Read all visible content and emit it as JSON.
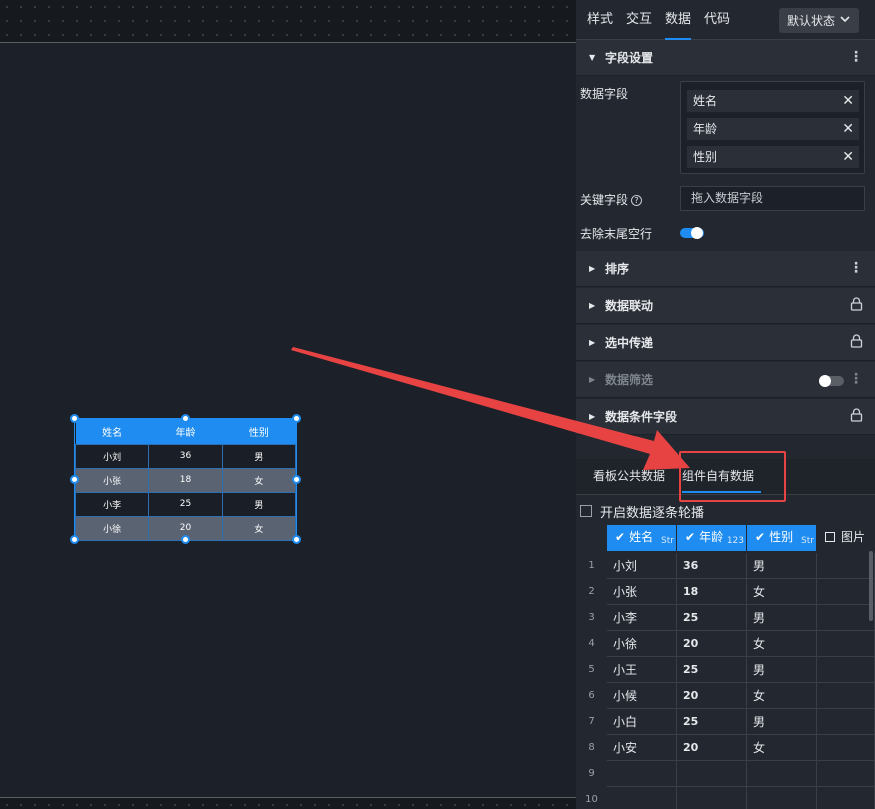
{
  "panel": {
    "tabs": [
      "样式",
      "交互",
      "数据",
      "代码"
    ],
    "active_tab": "数据",
    "state_select": "默认状态"
  },
  "field_settings": {
    "title": "字段设置",
    "data_fields_label": "数据字段",
    "data_fields": [
      "姓名",
      "年龄",
      "性别"
    ],
    "key_field_label": "关键字段",
    "key_field_placeholder": "拖入数据字段",
    "trim_empty_label": "去除末尾空行",
    "trim_empty_on": true
  },
  "sections": {
    "sort": "排序",
    "linkage": "数据联动",
    "selection": "选中传递",
    "filter": "数据筛选",
    "conditional": "数据条件字段"
  },
  "data_source_tabs": {
    "public": "看板公共数据",
    "own": "组件自有数据",
    "active": "own"
  },
  "loop_label": "开启数据逐条轮播",
  "grid": {
    "columns": [
      {
        "name": "姓名",
        "type": "Str"
      },
      {
        "name": "年龄",
        "type": "123"
      },
      {
        "name": "性别",
        "type": "Str"
      },
      {
        "name": "图片",
        "type": ""
      }
    ],
    "rows": [
      [
        "小刘",
        "36",
        "男"
      ],
      [
        "小张",
        "18",
        "女"
      ],
      [
        "小李",
        "25",
        "男"
      ],
      [
        "小徐",
        "20",
        "女"
      ],
      [
        "小王",
        "25",
        "男"
      ],
      [
        "小候",
        "20",
        "女"
      ],
      [
        "小白",
        "25",
        "男"
      ],
      [
        "小安",
        "20",
        "女"
      ],
      [
        "",
        "",
        ""
      ],
      [
        "",
        "",
        ""
      ]
    ]
  },
  "widget_table": {
    "headers": [
      "姓名",
      "年龄",
      "性别"
    ],
    "rows": [
      [
        "小刘",
        "36",
        "男"
      ],
      [
        "小张",
        "18",
        "女"
      ],
      [
        "小李",
        "25",
        "男"
      ],
      [
        "小徐",
        "20",
        "女"
      ]
    ]
  },
  "icons": {
    "close": "close-icon",
    "more": "more-icon",
    "lock": "lock-icon",
    "help": "help-icon"
  },
  "colors": {
    "accent": "#1e8cf0",
    "highlight": "#e84343"
  }
}
